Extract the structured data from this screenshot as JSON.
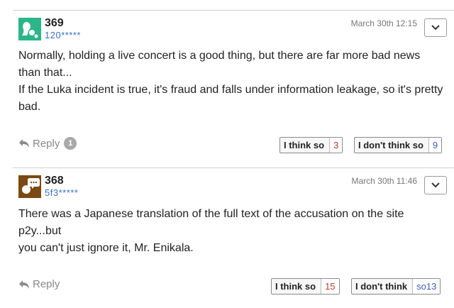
{
  "comments": [
    {
      "number": "369",
      "user_id": "120*****",
      "date": "March 30th 12:15",
      "lines": [
        "Normally, holding a live concert is a good thing, but there are far more bad news than that...",
        "If the Luka incident is true, it's fraud and falls under information leakage, so it's pretty bad."
      ],
      "reply_label": "Reply",
      "reply_count": "1",
      "agree_label": "I think so",
      "agree_count": "3",
      "disagree_label": "I don't think so",
      "disagree_count": "9",
      "avatar_color": "#2db58a"
    },
    {
      "number": "368",
      "user_id": "5f3*****",
      "date": "March 30th 11:46",
      "lines": [
        "There was a Japanese translation of the full text of the accusation on the site p2y...but",
        "you can't just ignore it, Mr. Enikala."
      ],
      "reply_label": "Reply",
      "agree_label": "I think so",
      "agree_count": "15",
      "disagree_label": "I don't think",
      "disagree_count": "so13",
      "avatar_color": "#7a4a12"
    }
  ],
  "icons": {
    "menu": "chevron-down-icon",
    "reply": "reply-arrow-icon"
  }
}
